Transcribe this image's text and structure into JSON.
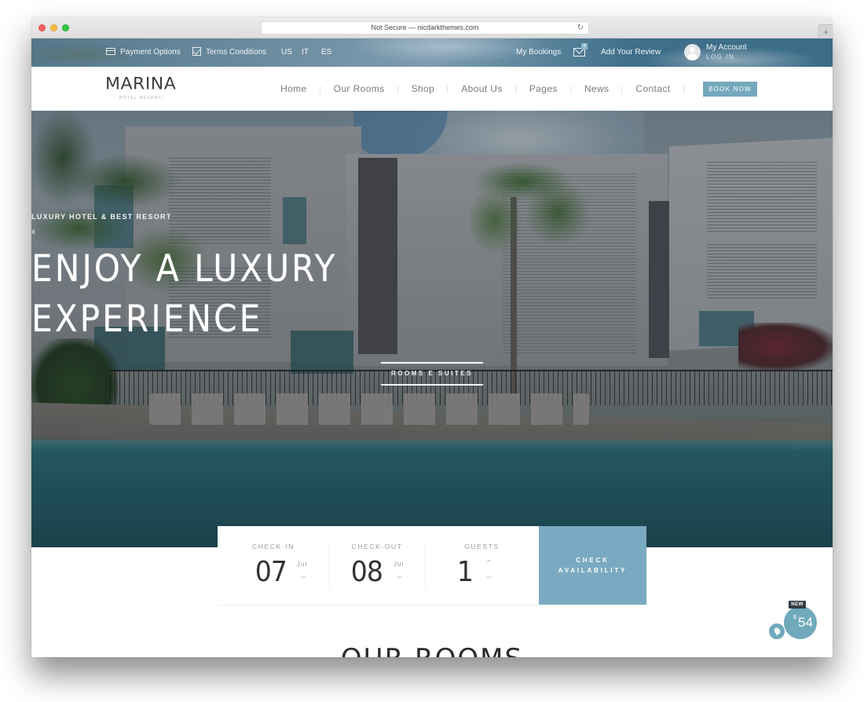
{
  "browser": {
    "address": "Not Secure — nicdarkthemes.com",
    "reload_icon": "reload-icon",
    "new_tab_icon": "plus-icon",
    "new_tab_label": "+"
  },
  "topbar": {
    "left_items": [
      {
        "label": "Payment Options",
        "icon": "credit-card-icon"
      },
      {
        "label": "Terms Conditions",
        "icon": "checkbox-icon"
      },
      {
        "label": "US"
      },
      {
        "label": "IT"
      },
      {
        "label": "ES"
      }
    ],
    "my_bookings": "My Bookings",
    "mail_badge_count": "4",
    "add_review": "Add Your Review",
    "account_title": "My Account",
    "account_login": "LOG IN"
  },
  "navbar": {
    "logo_title": "MARINA",
    "logo_subtitle": "· HOTEL RESORT ·",
    "links": [
      "Home",
      "Our Rooms",
      "Shop",
      "About Us",
      "Pages",
      "News",
      "Contact"
    ],
    "cta": "BOOK NOW",
    "accent_color": "#74a8bd"
  },
  "hero": {
    "kicker": "LUXURY HOTEL & BEST RESORT",
    "separator": "x",
    "title_line1": "ENJOY A LUXURY",
    "title_line2": "EXPERIENCE",
    "button": "ROOMS E SUITES"
  },
  "booking": {
    "checkin": {
      "label": "CHECK-IN",
      "day": "07",
      "month": "Jul"
    },
    "checkout": {
      "label": "CHECK-OUT",
      "day": "08",
      "month": "Jul"
    },
    "guests": {
      "label": "GUESTS",
      "value": "1"
    },
    "submit_line1": "CHECK",
    "submit_line2": "AVAILABILITY",
    "submit_color": "#7aaac1"
  },
  "section": {
    "rooms_title": "OUR ROOMS"
  },
  "cart_widget": {
    "badge": "NEW",
    "currency": "$",
    "amount": "54"
  }
}
